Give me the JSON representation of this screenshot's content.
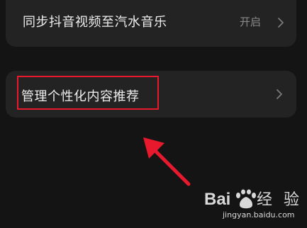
{
  "settings": {
    "sync_row": {
      "label": "同步抖音视频至汽水音乐",
      "value": "开启"
    },
    "personalized_row": {
      "label": "管理个性化内容推荐"
    }
  },
  "annotation": {
    "highlight_color": "#e8192c",
    "arrow_icon": "arrow-up-left-icon"
  },
  "watermark": {
    "brand": "Baidu经验",
    "url": "jingyan.baidu.com"
  },
  "colors": {
    "background": "#141414",
    "card": "#232323",
    "text_primary": "#eeeeee",
    "text_secondary": "#8a8a8a"
  }
}
